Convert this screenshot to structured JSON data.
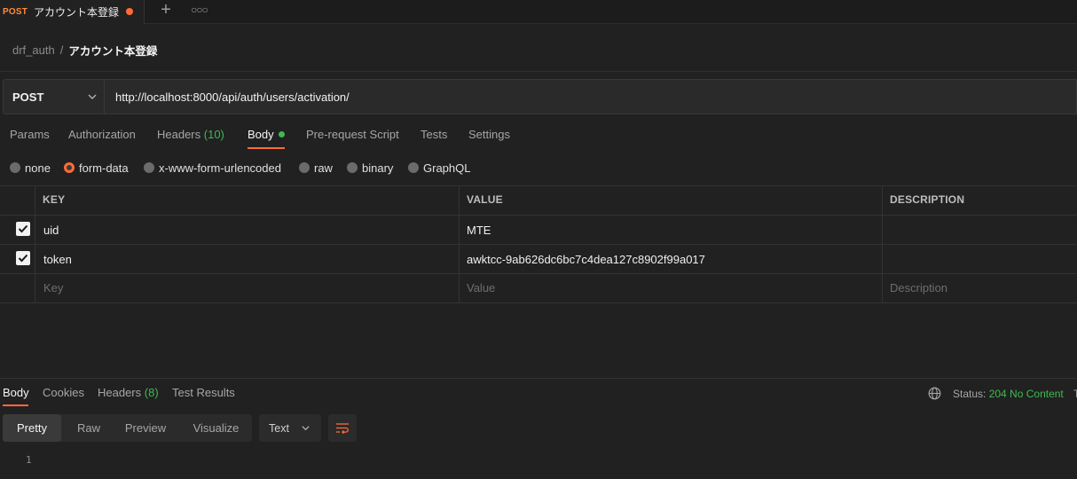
{
  "tab": {
    "method": "POST",
    "title": "アカウント本登録"
  },
  "breadcrumb": {
    "collection": "drf_auth",
    "separator": "/",
    "request": "アカウント本登録"
  },
  "request": {
    "method": "POST",
    "url": "http://localhost:8000/api/auth/users/activation/"
  },
  "request_tabs": [
    {
      "label": "Params"
    },
    {
      "label": "Authorization"
    },
    {
      "label": "Headers",
      "count": "(10)"
    },
    {
      "label": "Body",
      "active": true
    },
    {
      "label": "Pre-request Script"
    },
    {
      "label": "Tests"
    },
    {
      "label": "Settings"
    }
  ],
  "body_types": [
    {
      "label": "none",
      "selected": false
    },
    {
      "label": "form-data",
      "selected": true
    },
    {
      "label": "x-www-form-urlencoded",
      "selected": false
    },
    {
      "label": "raw",
      "selected": false
    },
    {
      "label": "binary",
      "selected": false
    },
    {
      "label": "GraphQL",
      "selected": false
    }
  ],
  "table": {
    "headers": {
      "key": "KEY",
      "value": "VALUE",
      "description": "DESCRIPTION"
    },
    "rows": [
      {
        "checked": true,
        "key": "uid",
        "value": "MTE",
        "description": ""
      },
      {
        "checked": true,
        "key": "token",
        "value": "awktcc-9ab626dc6bc7c4dea127c8902f99a017",
        "description": ""
      }
    ],
    "placeholders": {
      "key": "Key",
      "value": "Value",
      "description": "Description"
    }
  },
  "response": {
    "tabs": [
      {
        "label": "Body",
        "active": true
      },
      {
        "label": "Cookies"
      },
      {
        "label": "Headers",
        "count": "(8)"
      },
      {
        "label": "Test Results"
      }
    ],
    "status_label": "Status:",
    "status_code": "204 No Content",
    "status_cut": "T",
    "view_modes": [
      "Pretty",
      "Raw",
      "Preview",
      "Visualize"
    ],
    "format": "Text",
    "line_number": "1"
  },
  "colors": {
    "accent": "#ff6c37",
    "success": "#3fb950",
    "background": "#212121"
  }
}
